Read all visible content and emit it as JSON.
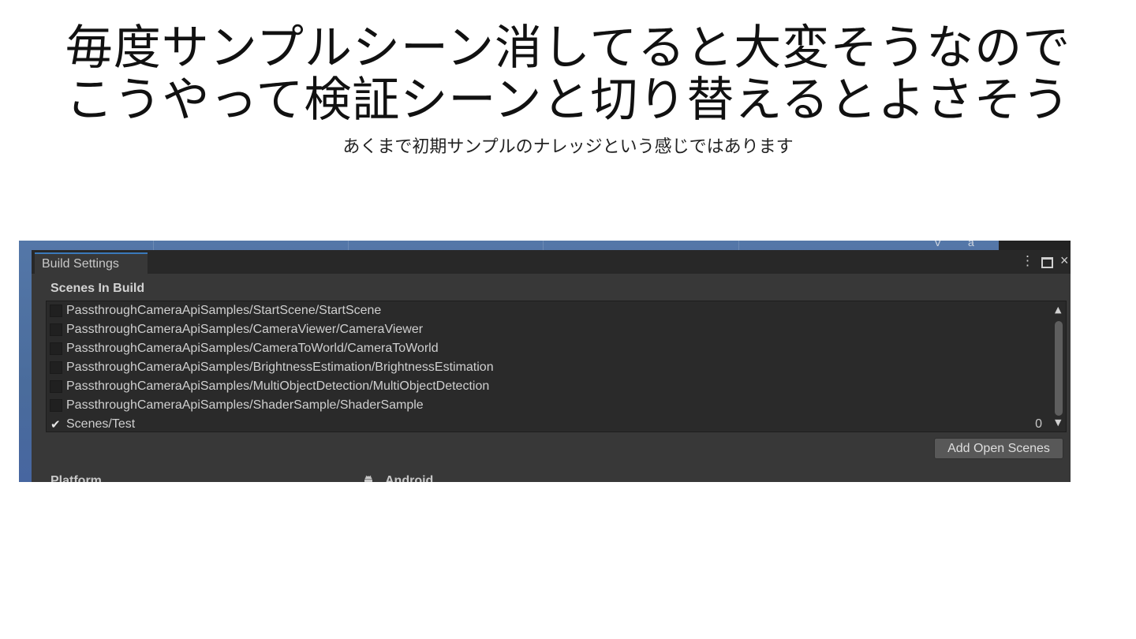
{
  "slide": {
    "title_lines": [
      "毎度サンプルシーン消してると大変そうなので",
      "こうやって検証シーンと切り替えるとよさそう"
    ],
    "subtitle": "あくまで初期サンプルのナレッジという感じではあります"
  },
  "screenshot": {
    "background_glyphs": [
      "V",
      "a"
    ],
    "window": {
      "tab_title": "Build Settings",
      "controls": {
        "menu": "⋮",
        "close": "×"
      }
    },
    "scenes_in_build": {
      "label": "Scenes In Build",
      "scenes": [
        {
          "name": "PassthroughCameraApiSamples/StartScene/StartScene",
          "checked": false,
          "index": ""
        },
        {
          "name": "PassthroughCameraApiSamples/CameraViewer/CameraViewer",
          "checked": false,
          "index": ""
        },
        {
          "name": "PassthroughCameraApiSamples/CameraToWorld/CameraToWorld",
          "checked": false,
          "index": ""
        },
        {
          "name": "PassthroughCameraApiSamples/BrightnessEstimation/BrightnessEstimation",
          "checked": false,
          "index": ""
        },
        {
          "name": "PassthroughCameraApiSamples/MultiObjectDetection/MultiObjectDetection",
          "checked": false,
          "index": ""
        },
        {
          "name": "PassthroughCameraApiSamples/ShaderSample/ShaderSample",
          "checked": false,
          "index": ""
        },
        {
          "name": "Scenes/Test",
          "checked": true,
          "index": "0"
        }
      ],
      "checkmark": "✔"
    },
    "add_open_scenes_label": "Add Open Scenes",
    "platform": {
      "label": "Platform",
      "selected": "Android",
      "icon": "android-icon"
    }
  }
}
